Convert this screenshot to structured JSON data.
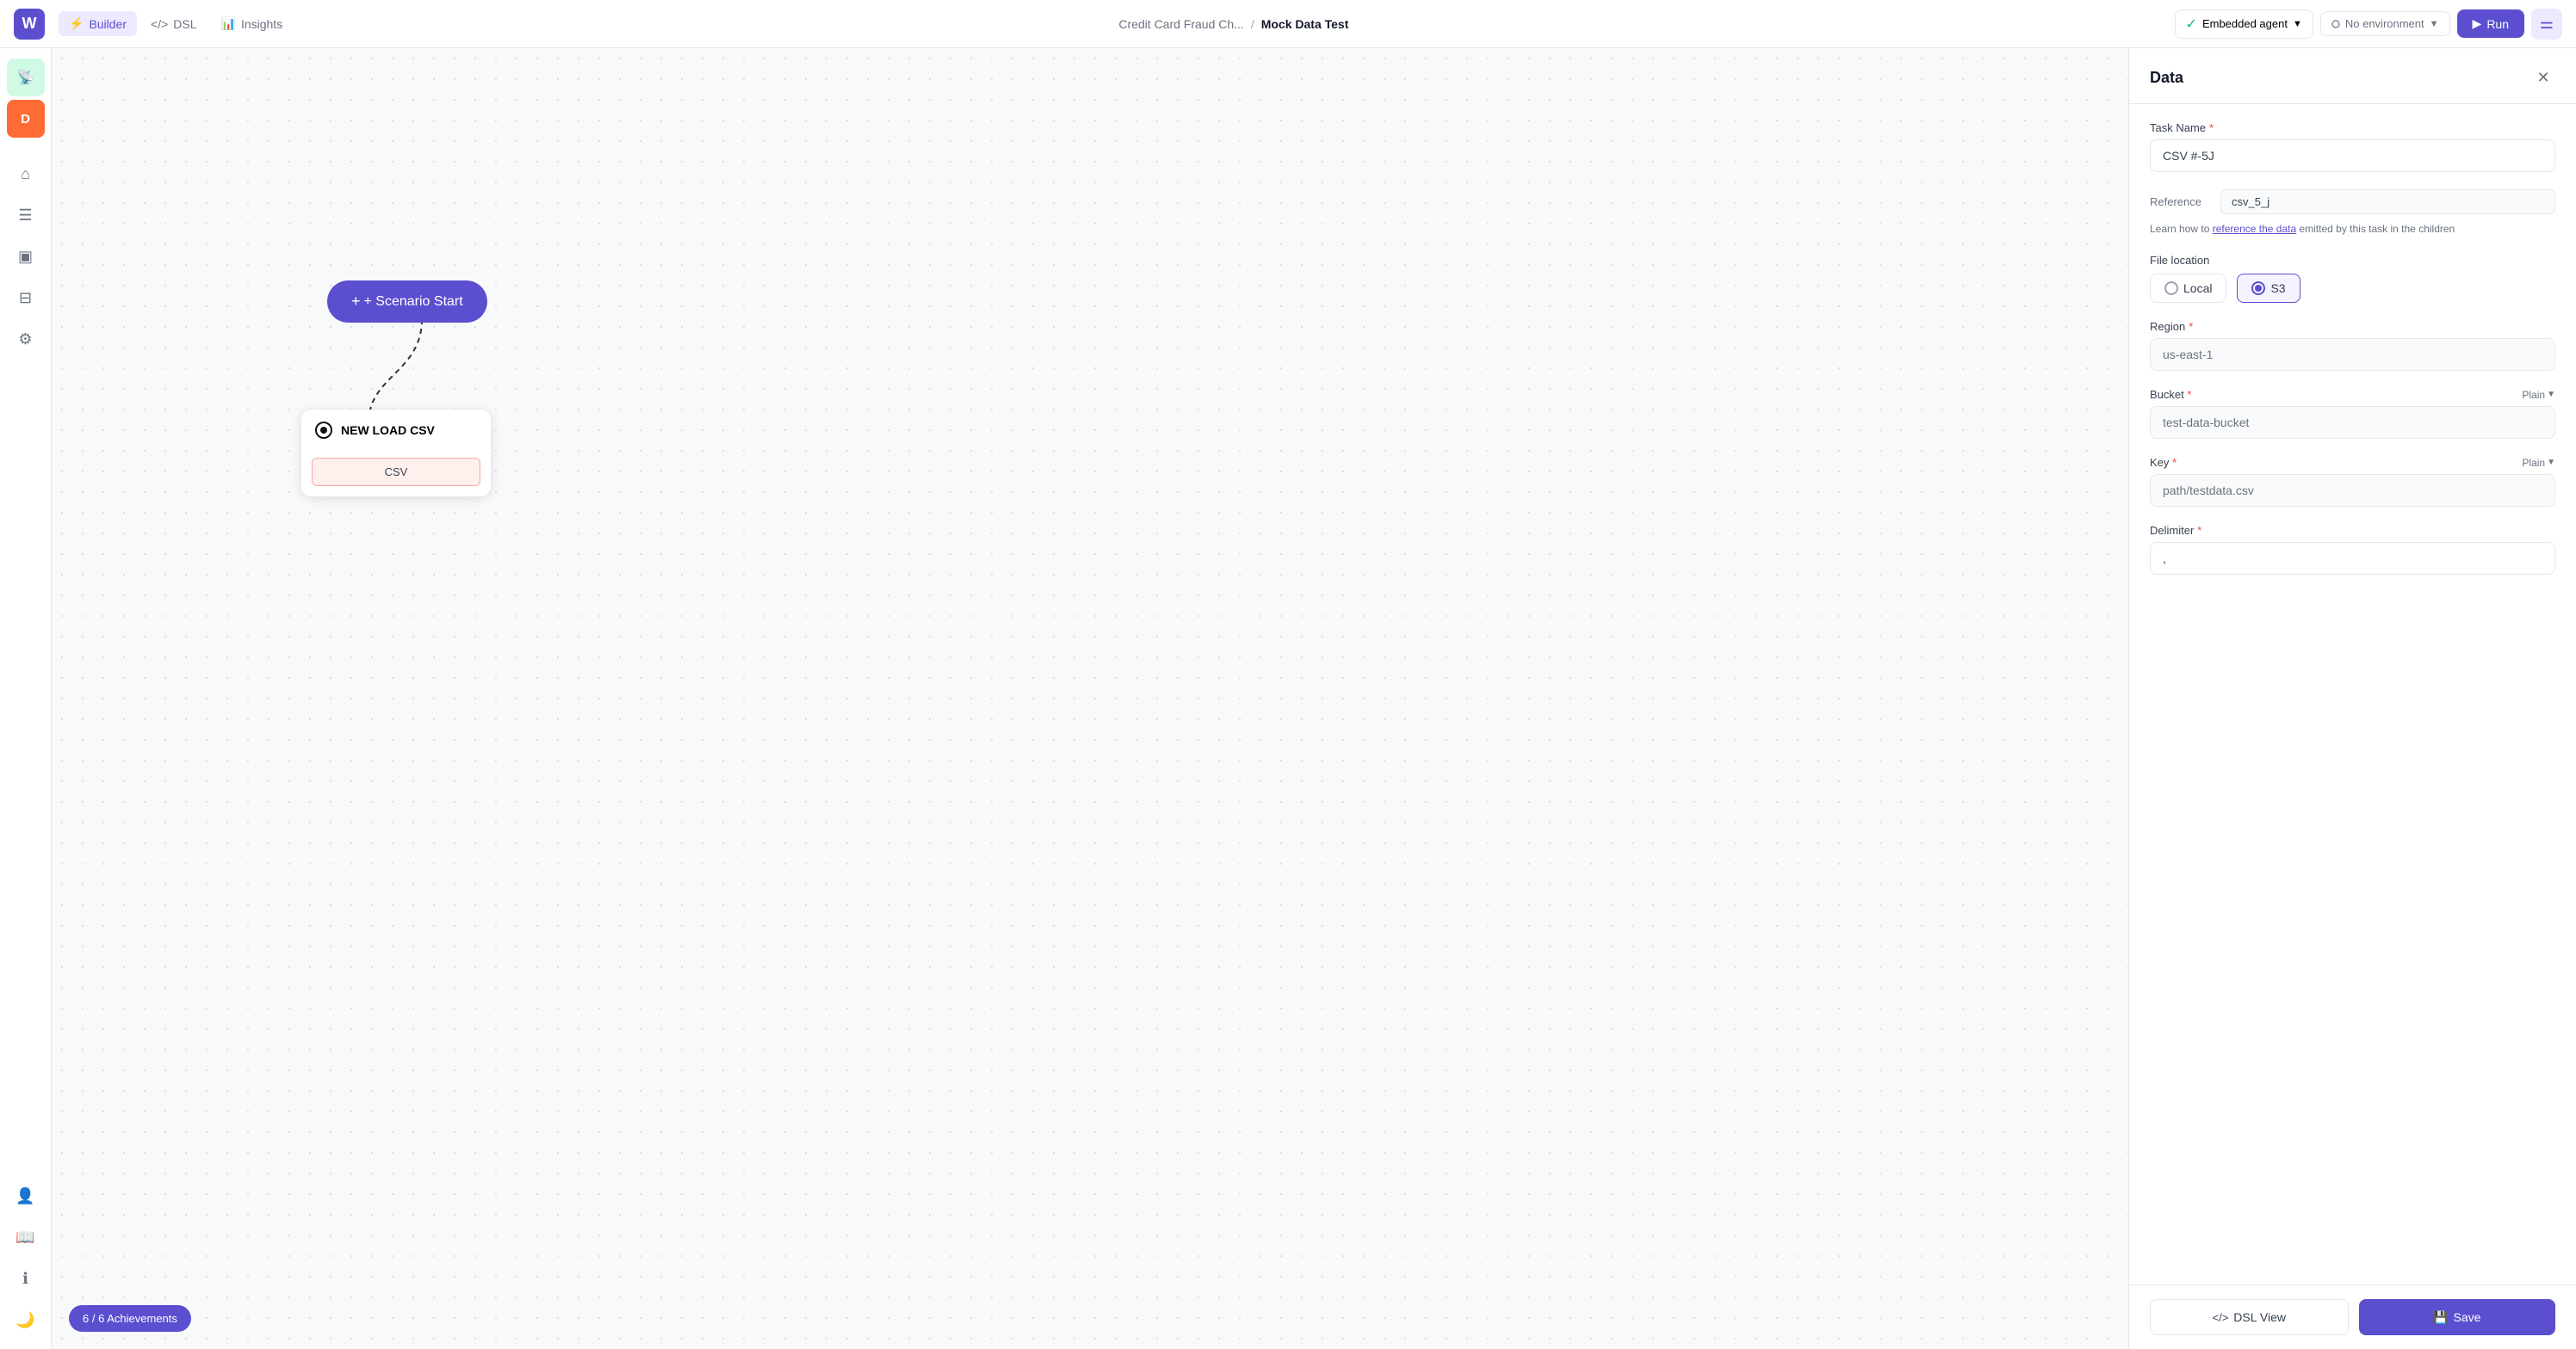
{
  "topbar": {
    "logo_letter": "W",
    "nav": {
      "builder_label": "Builder",
      "dsl_label": "DSL",
      "insights_label": "Insights"
    },
    "breadcrumb_parent": "Credit Card Fraud Ch...",
    "breadcrumb_sep": "/",
    "breadcrumb_current": "Mock Data Test",
    "agent_label": "Embedded agent",
    "env_label": "No environment",
    "run_label": "Run",
    "settings_icon": "⚙"
  },
  "sidebar": {
    "items": [
      {
        "icon": "📡",
        "name": "signal-icon",
        "active": true
      },
      {
        "icon": "D",
        "name": "d-icon",
        "orange": true
      },
      {
        "icon": "⌂",
        "name": "home-icon"
      },
      {
        "icon": "☰",
        "name": "list-icon"
      },
      {
        "icon": "▣",
        "name": "grid-icon"
      },
      {
        "icon": "⊞",
        "name": "layout-icon"
      },
      {
        "icon": "⚙",
        "name": "org-icon"
      },
      {
        "icon": "👤",
        "name": "user-icon"
      },
      {
        "icon": "📖",
        "name": "book-icon"
      },
      {
        "icon": "ℹ",
        "name": "info-icon"
      },
      {
        "icon": "🌙",
        "name": "moon-icon"
      }
    ],
    "achievements_label": "6 / 6 Achievements",
    "collapse_icon": "›"
  },
  "canvas": {
    "scenario_start_label": "+ Scenario Start",
    "node_title": "NEW LOAD CSV",
    "node_chip": "CSV"
  },
  "panel": {
    "title": "Data",
    "close_icon": "✕",
    "task_name_label": "Task Name",
    "task_name_required": "*",
    "task_name_value": "CSV #-5J",
    "reference_label": "Reference",
    "reference_value": "csv_5_j",
    "reference_help": "Learn how to reference the data emitted by this task in the children",
    "reference_help_link": "reference the data",
    "file_location_label": "File location",
    "file_location_local": "Local",
    "file_location_s3": "S3",
    "region_label": "Region",
    "region_required": "*",
    "region_value": "us-east-1",
    "bucket_label": "Bucket",
    "bucket_required": "*",
    "bucket_plain": "Plain",
    "bucket_value": "test-data-bucket",
    "key_label": "Key",
    "key_required": "*",
    "key_plain": "Plain",
    "key_value": "path/testdata.csv",
    "delimiter_label": "Delimiter",
    "delimiter_required": "*",
    "delimiter_value": ",",
    "dsl_view_label": "DSL View",
    "save_label": "Save",
    "dsl_icon": "<>",
    "save_icon": "💾"
  }
}
